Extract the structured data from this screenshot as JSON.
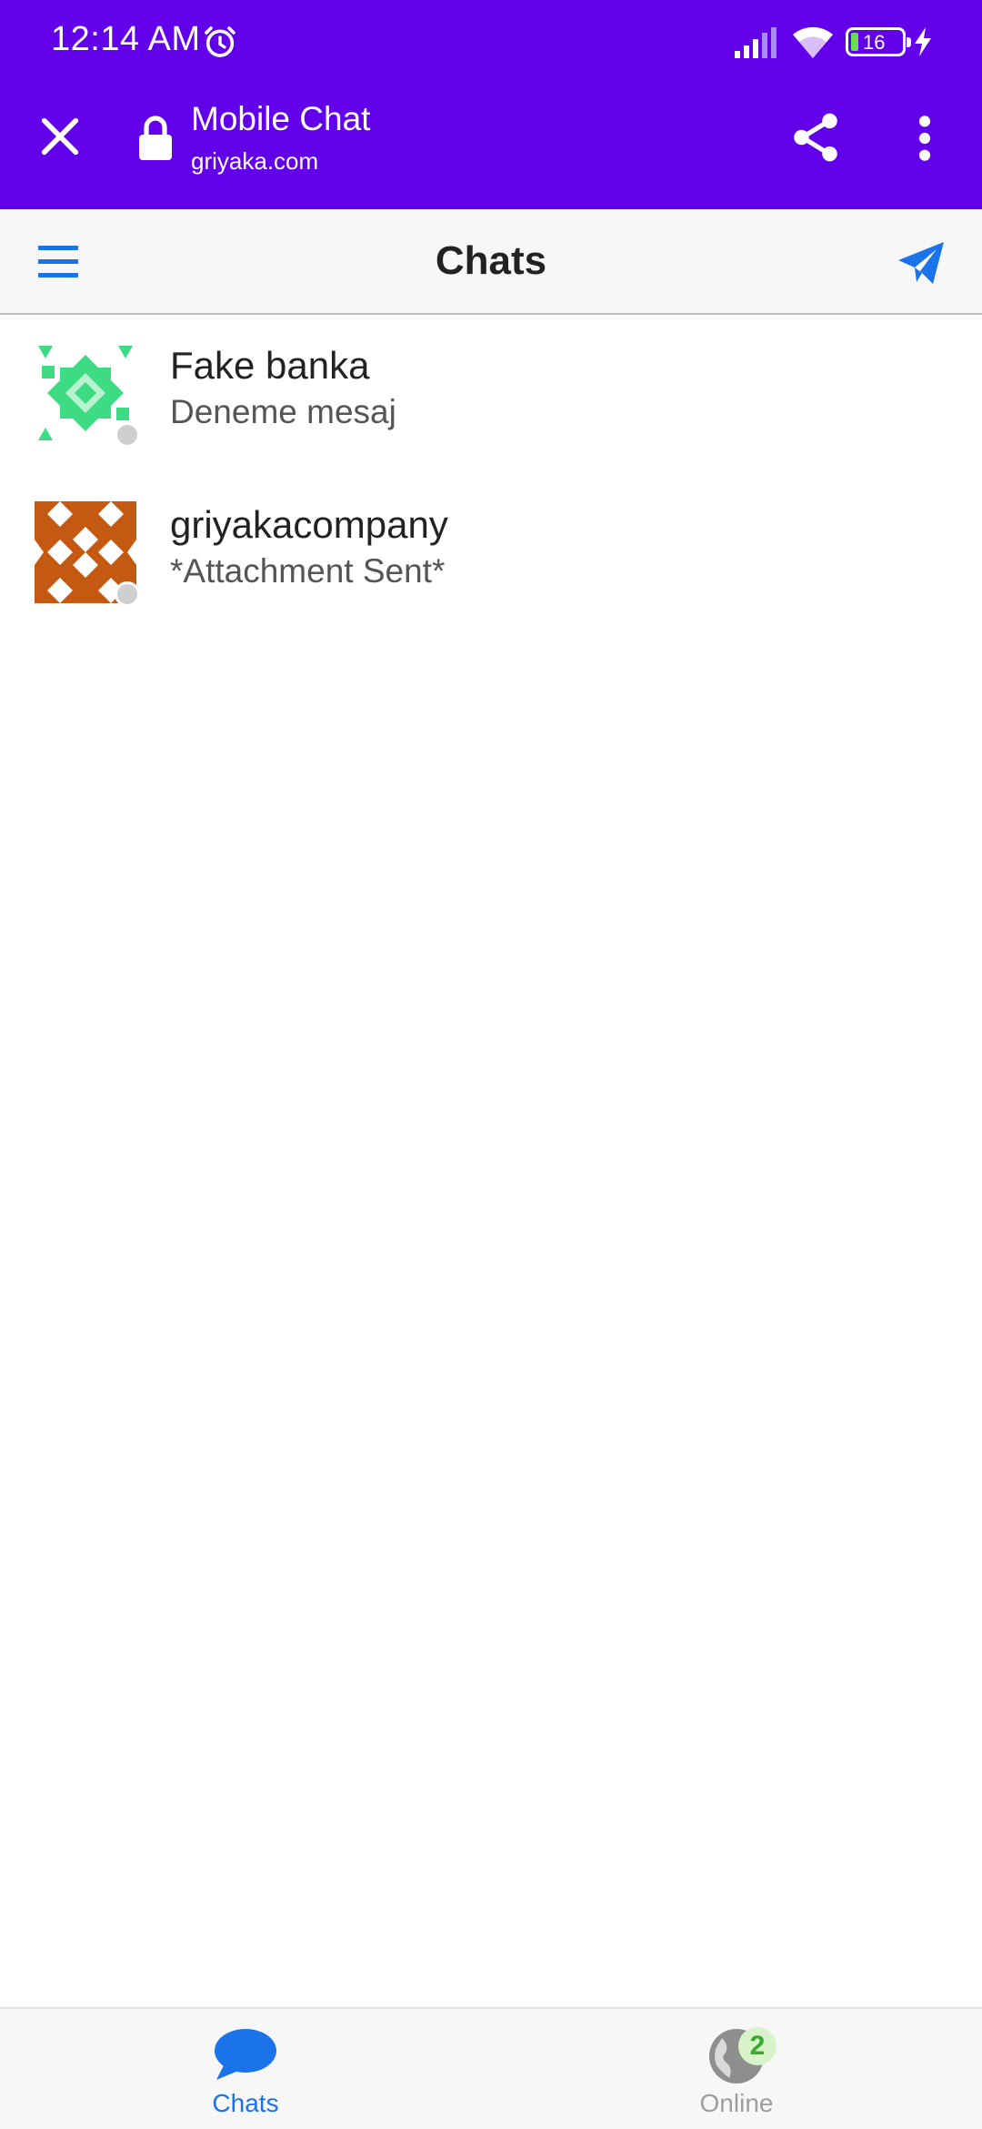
{
  "status_bar": {
    "time": "12:14 AM",
    "battery_level": "16",
    "icons": [
      "alarm-icon",
      "signal-icon",
      "wifi-icon",
      "battery-icon",
      "charging-icon"
    ]
  },
  "browser": {
    "title": "Mobile Chat",
    "url": "griyaka.com",
    "icons": [
      "close-icon",
      "lock-icon",
      "share-icon",
      "more-vert-icon"
    ],
    "toolbar_color": "#6200ea"
  },
  "header": {
    "title": "Chats",
    "accent_color": "#1a73e8"
  },
  "chats": [
    {
      "name": "Fake banka",
      "preview": "Deneme mesaj",
      "avatar_color": "#3ddc84"
    },
    {
      "name": "griyakacompany",
      "preview": "*Attachment Sent*",
      "avatar_color": "#c45a12"
    }
  ],
  "bottom_nav": {
    "tabs": [
      {
        "label": "Chats",
        "icon": "chat-bubble-icon",
        "active": true
      },
      {
        "label": "Online",
        "icon": "globe-icon",
        "badge": "2",
        "active": false
      }
    ]
  }
}
